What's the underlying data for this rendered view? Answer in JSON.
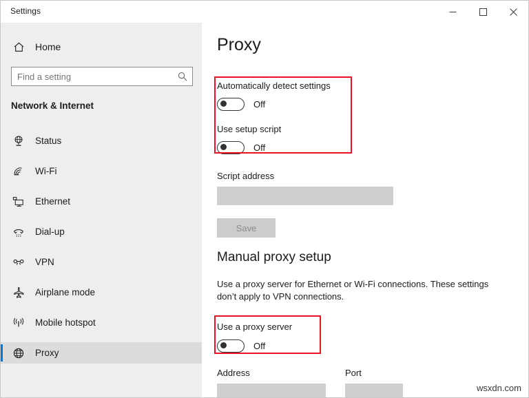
{
  "window": {
    "title": "Settings",
    "controls": [
      {
        "name": "minimize",
        "label": "Minimize"
      },
      {
        "name": "maximize",
        "label": "Maximize"
      },
      {
        "name": "close",
        "label": "Close"
      }
    ]
  },
  "sidebar": {
    "home_label": "Home",
    "home_icon": "home-icon",
    "search": {
      "placeholder": "Find a setting",
      "value": "",
      "icon": "search-icon"
    },
    "category": "Network & Internet",
    "items": [
      {
        "label": "Status",
        "icon": "network-status-icon",
        "selected": false
      },
      {
        "label": "Wi-Fi",
        "icon": "wifi-icon",
        "selected": false
      },
      {
        "label": "Ethernet",
        "icon": "ethernet-monitor-icon",
        "selected": false
      },
      {
        "label": "Dial-up",
        "icon": "dialup-phone-icon",
        "selected": false
      },
      {
        "label": "VPN",
        "icon": "vpn-key-icon",
        "selected": false
      },
      {
        "label": "Airplane mode",
        "icon": "airplane-icon",
        "selected": false
      },
      {
        "label": "Mobile hotspot",
        "icon": "hotspot-broadcast-icon",
        "selected": false
      },
      {
        "label": "Proxy",
        "icon": "globe-icon",
        "selected": true
      }
    ]
  },
  "main": {
    "title": "Proxy",
    "automatic_setup": {
      "auto_detect": {
        "label": "Automatically detect settings",
        "state": "Off",
        "checked": false
      },
      "setup_script": {
        "label": "Use setup script",
        "state": "Off",
        "checked": false
      },
      "script_address": {
        "label": "Script address",
        "value": "",
        "disabled": true
      },
      "save_button": {
        "label": "Save",
        "disabled": true
      }
    },
    "manual_setup": {
      "heading": "Manual proxy setup",
      "description": "Use a proxy server for Ethernet or Wi-Fi connections. These settings don’t apply to VPN connections.",
      "use_proxy": {
        "label": "Use a proxy server",
        "state": "Off",
        "checked": false
      },
      "address": {
        "label": "Address",
        "value": "",
        "disabled": true
      },
      "port": {
        "label": "Port",
        "value": "",
        "disabled": true
      }
    }
  },
  "annotations": {
    "accent_color": "#e81226",
    "boxes": [
      {
        "name": "automatic-setup-highlight"
      },
      {
        "name": "use-proxy-server-highlight"
      }
    ]
  },
  "watermark": "wsxdn.com"
}
